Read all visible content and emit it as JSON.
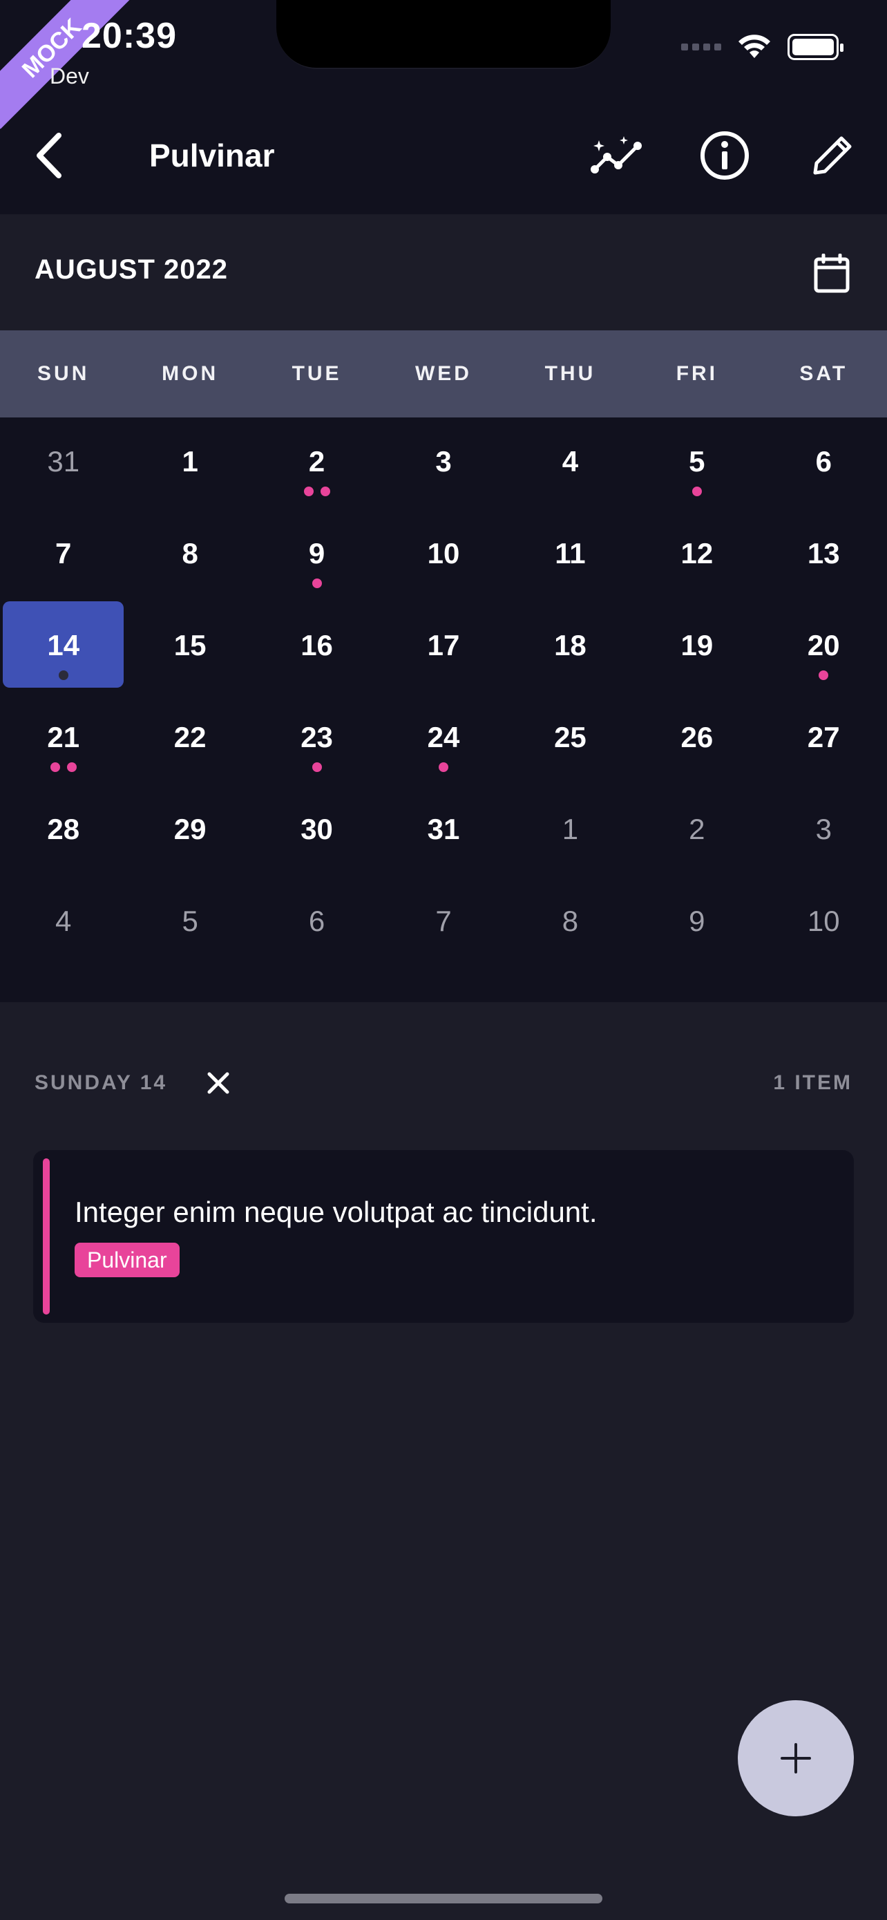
{
  "status_bar": {
    "time": "20:39",
    "env": "Dev",
    "ribbon": "MOCK"
  },
  "nav": {
    "title": "Pulvinar",
    "icons": [
      "back-icon",
      "insights-icon",
      "info-icon",
      "edit-icon"
    ]
  },
  "calendar": {
    "month_label": "AUGUST 2022",
    "weekdays": [
      "SUN",
      "MON",
      "TUE",
      "WED",
      "THU",
      "FRI",
      "SAT"
    ],
    "days": [
      {
        "label": "31",
        "muted": true,
        "dots": 0
      },
      {
        "label": "1",
        "muted": false,
        "dots": 0
      },
      {
        "label": "2",
        "muted": false,
        "dots": 2
      },
      {
        "label": "3",
        "muted": false,
        "dots": 0
      },
      {
        "label": "4",
        "muted": false,
        "dots": 0
      },
      {
        "label": "5",
        "muted": false,
        "dots": 1
      },
      {
        "label": "6",
        "muted": false,
        "dots": 0
      },
      {
        "label": "7",
        "muted": false,
        "dots": 0
      },
      {
        "label": "8",
        "muted": false,
        "dots": 0
      },
      {
        "label": "9",
        "muted": false,
        "dots": 1
      },
      {
        "label": "10",
        "muted": false,
        "dots": 0
      },
      {
        "label": "11",
        "muted": false,
        "dots": 0
      },
      {
        "label": "12",
        "muted": false,
        "dots": 0
      },
      {
        "label": "13",
        "muted": false,
        "dots": 0
      },
      {
        "label": "14",
        "muted": false,
        "dots": 1,
        "selected": true
      },
      {
        "label": "15",
        "muted": false,
        "dots": 0
      },
      {
        "label": "16",
        "muted": false,
        "dots": 0
      },
      {
        "label": "17",
        "muted": false,
        "dots": 0
      },
      {
        "label": "18",
        "muted": false,
        "dots": 0
      },
      {
        "label": "19",
        "muted": false,
        "dots": 0
      },
      {
        "label": "20",
        "muted": false,
        "dots": 1
      },
      {
        "label": "21",
        "muted": false,
        "dots": 2
      },
      {
        "label": "22",
        "muted": false,
        "dots": 0
      },
      {
        "label": "23",
        "muted": false,
        "dots": 1
      },
      {
        "label": "24",
        "muted": false,
        "dots": 1
      },
      {
        "label": "25",
        "muted": false,
        "dots": 0
      },
      {
        "label": "26",
        "muted": false,
        "dots": 0
      },
      {
        "label": "27",
        "muted": false,
        "dots": 0
      },
      {
        "label": "28",
        "muted": false,
        "dots": 0
      },
      {
        "label": "29",
        "muted": false,
        "dots": 0
      },
      {
        "label": "30",
        "muted": false,
        "dots": 0
      },
      {
        "label": "31",
        "muted": false,
        "dots": 0
      },
      {
        "label": "1",
        "muted": true,
        "dots": 0
      },
      {
        "label": "2",
        "muted": true,
        "dots": 0
      },
      {
        "label": "3",
        "muted": true,
        "dots": 0
      },
      {
        "label": "4",
        "muted": true,
        "dots": 0
      },
      {
        "label": "5",
        "muted": true,
        "dots": 0
      },
      {
        "label": "6",
        "muted": true,
        "dots": 0
      },
      {
        "label": "7",
        "muted": true,
        "dots": 0
      },
      {
        "label": "8",
        "muted": true,
        "dots": 0
      },
      {
        "label": "9",
        "muted": true,
        "dots": 0
      },
      {
        "label": "10",
        "muted": true,
        "dots": 0
      }
    ]
  },
  "selection": {
    "date_label": "SUNDAY 14",
    "count_label": "1 ITEM"
  },
  "events": [
    {
      "title": "Integer enim neque volutpat ac tincidunt.",
      "tag": "Pulvinar",
      "color": "#e8449a"
    }
  ],
  "colors": {
    "background": "#1c1c28",
    "surface": "#11111e",
    "weekday_bar": "#474a62",
    "selected_day": "#3f51b5",
    "accent_pink": "#e8449a",
    "fab": "#c9c9de"
  }
}
